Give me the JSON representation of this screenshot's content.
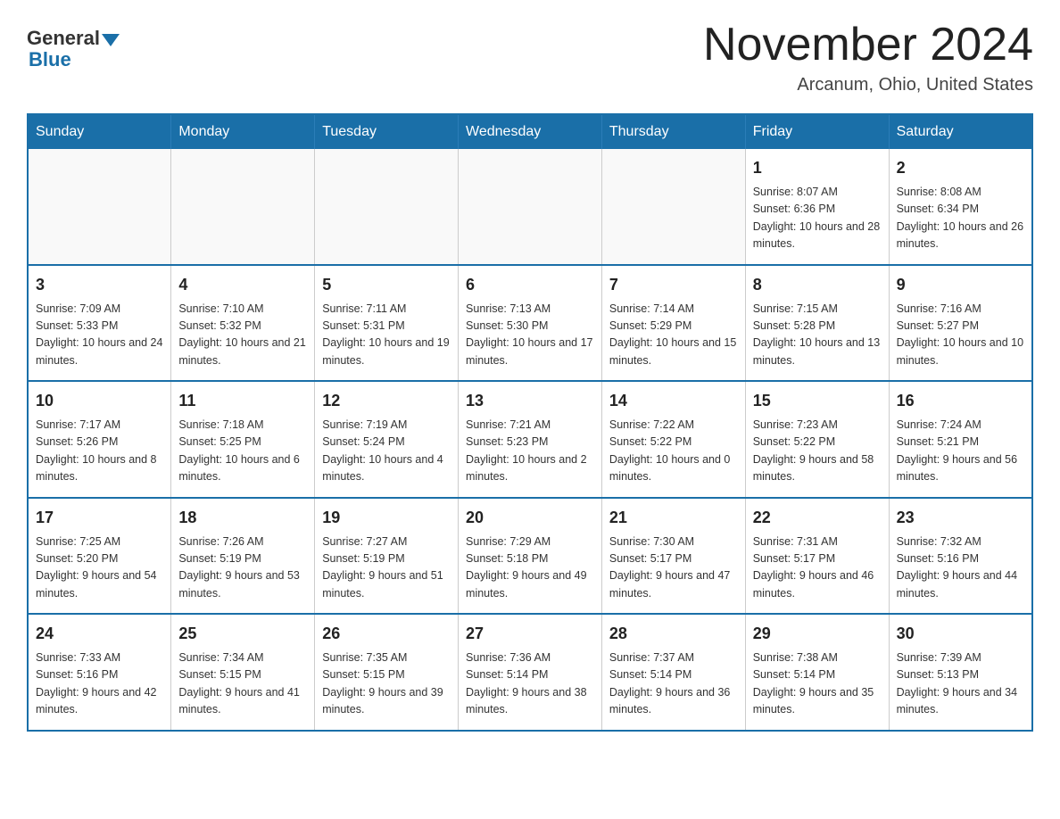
{
  "header": {
    "logo_general": "General",
    "logo_blue": "Blue",
    "month_title": "November 2024",
    "location": "Arcanum, Ohio, United States"
  },
  "weekdays": [
    "Sunday",
    "Monday",
    "Tuesday",
    "Wednesday",
    "Thursday",
    "Friday",
    "Saturday"
  ],
  "weeks": [
    [
      {
        "day": "",
        "info": ""
      },
      {
        "day": "",
        "info": ""
      },
      {
        "day": "",
        "info": ""
      },
      {
        "day": "",
        "info": ""
      },
      {
        "day": "",
        "info": ""
      },
      {
        "day": "1",
        "info": "Sunrise: 8:07 AM\nSunset: 6:36 PM\nDaylight: 10 hours and 28 minutes."
      },
      {
        "day": "2",
        "info": "Sunrise: 8:08 AM\nSunset: 6:34 PM\nDaylight: 10 hours and 26 minutes."
      }
    ],
    [
      {
        "day": "3",
        "info": "Sunrise: 7:09 AM\nSunset: 5:33 PM\nDaylight: 10 hours and 24 minutes."
      },
      {
        "day": "4",
        "info": "Sunrise: 7:10 AM\nSunset: 5:32 PM\nDaylight: 10 hours and 21 minutes."
      },
      {
        "day": "5",
        "info": "Sunrise: 7:11 AM\nSunset: 5:31 PM\nDaylight: 10 hours and 19 minutes."
      },
      {
        "day": "6",
        "info": "Sunrise: 7:13 AM\nSunset: 5:30 PM\nDaylight: 10 hours and 17 minutes."
      },
      {
        "day": "7",
        "info": "Sunrise: 7:14 AM\nSunset: 5:29 PM\nDaylight: 10 hours and 15 minutes."
      },
      {
        "day": "8",
        "info": "Sunrise: 7:15 AM\nSunset: 5:28 PM\nDaylight: 10 hours and 13 minutes."
      },
      {
        "day": "9",
        "info": "Sunrise: 7:16 AM\nSunset: 5:27 PM\nDaylight: 10 hours and 10 minutes."
      }
    ],
    [
      {
        "day": "10",
        "info": "Sunrise: 7:17 AM\nSunset: 5:26 PM\nDaylight: 10 hours and 8 minutes."
      },
      {
        "day": "11",
        "info": "Sunrise: 7:18 AM\nSunset: 5:25 PM\nDaylight: 10 hours and 6 minutes."
      },
      {
        "day": "12",
        "info": "Sunrise: 7:19 AM\nSunset: 5:24 PM\nDaylight: 10 hours and 4 minutes."
      },
      {
        "day": "13",
        "info": "Sunrise: 7:21 AM\nSunset: 5:23 PM\nDaylight: 10 hours and 2 minutes."
      },
      {
        "day": "14",
        "info": "Sunrise: 7:22 AM\nSunset: 5:22 PM\nDaylight: 10 hours and 0 minutes."
      },
      {
        "day": "15",
        "info": "Sunrise: 7:23 AM\nSunset: 5:22 PM\nDaylight: 9 hours and 58 minutes."
      },
      {
        "day": "16",
        "info": "Sunrise: 7:24 AM\nSunset: 5:21 PM\nDaylight: 9 hours and 56 minutes."
      }
    ],
    [
      {
        "day": "17",
        "info": "Sunrise: 7:25 AM\nSunset: 5:20 PM\nDaylight: 9 hours and 54 minutes."
      },
      {
        "day": "18",
        "info": "Sunrise: 7:26 AM\nSunset: 5:19 PM\nDaylight: 9 hours and 53 minutes."
      },
      {
        "day": "19",
        "info": "Sunrise: 7:27 AM\nSunset: 5:19 PM\nDaylight: 9 hours and 51 minutes."
      },
      {
        "day": "20",
        "info": "Sunrise: 7:29 AM\nSunset: 5:18 PM\nDaylight: 9 hours and 49 minutes."
      },
      {
        "day": "21",
        "info": "Sunrise: 7:30 AM\nSunset: 5:17 PM\nDaylight: 9 hours and 47 minutes."
      },
      {
        "day": "22",
        "info": "Sunrise: 7:31 AM\nSunset: 5:17 PM\nDaylight: 9 hours and 46 minutes."
      },
      {
        "day": "23",
        "info": "Sunrise: 7:32 AM\nSunset: 5:16 PM\nDaylight: 9 hours and 44 minutes."
      }
    ],
    [
      {
        "day": "24",
        "info": "Sunrise: 7:33 AM\nSunset: 5:16 PM\nDaylight: 9 hours and 42 minutes."
      },
      {
        "day": "25",
        "info": "Sunrise: 7:34 AM\nSunset: 5:15 PM\nDaylight: 9 hours and 41 minutes."
      },
      {
        "day": "26",
        "info": "Sunrise: 7:35 AM\nSunset: 5:15 PM\nDaylight: 9 hours and 39 minutes."
      },
      {
        "day": "27",
        "info": "Sunrise: 7:36 AM\nSunset: 5:14 PM\nDaylight: 9 hours and 38 minutes."
      },
      {
        "day": "28",
        "info": "Sunrise: 7:37 AM\nSunset: 5:14 PM\nDaylight: 9 hours and 36 minutes."
      },
      {
        "day": "29",
        "info": "Sunrise: 7:38 AM\nSunset: 5:14 PM\nDaylight: 9 hours and 35 minutes."
      },
      {
        "day": "30",
        "info": "Sunrise: 7:39 AM\nSunset: 5:13 PM\nDaylight: 9 hours and 34 minutes."
      }
    ]
  ]
}
